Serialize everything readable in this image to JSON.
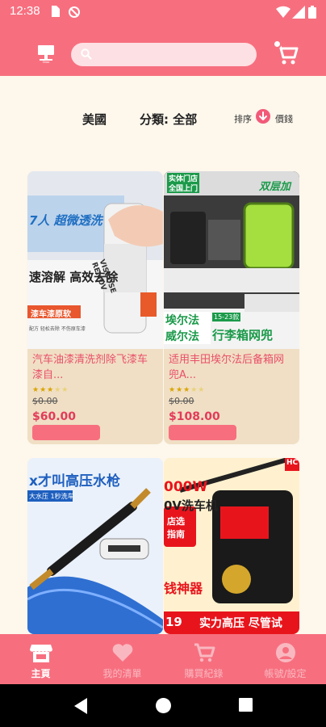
{
  "status_bar": {
    "time": "12:38"
  },
  "header": {
    "logo_icon": "shop-logo-icon",
    "search": {
      "placeholder": "",
      "value": ""
    },
    "cart_icon": "cart-icon"
  },
  "filters": {
    "region": "美國",
    "category": "分類: 全部",
    "sort_label": "排序",
    "sort_value": "價錢"
  },
  "products": [
    {
      "name": "汽车油漆清洗剂除飞漆车漆自...",
      "stars": 3,
      "old_price": "$0.00",
      "price": "$60.00"
    },
    {
      "name": "适用丰田埃尔法后备箱网兜A...",
      "stars": 3,
      "old_price": "$0.00",
      "price": "$108.00"
    },
    {
      "name": "",
      "stars": 0,
      "old_price": "",
      "price": ""
    },
    {
      "name": "",
      "stars": 0,
      "old_price": "",
      "price": ""
    }
  ],
  "image_texts": {
    "p1_banner": "7人 超微透洗",
    "p1_line1": "速溶解 高效去除",
    "p1_tag": "漆车漆原软",
    "p1_small": "配方 轻松去除 不伤原车漆",
    "p1_can": "VISCOSE REMOV",
    "p2_tag1": "实体门店",
    "p2_tag2": "全国上门",
    "p2_top": "双层加",
    "p2_range": "15-23款",
    "p2_brand1": "埃尔法",
    "p2_brand2": "威尔法",
    "p2_bottom": "行李箱网兜",
    "p3_top": "x才叫高压水枪",
    "p3_small": "大水压 1秒洗车",
    "p4_top": "000W",
    "p4_sub": "0V洗车机",
    "p4_side1": "店选",
    "p4_side2": "指南",
    "p4_mid": "钱神器",
    "p4_num": "19",
    "p4_bottom": "实力高压 尽管试",
    "p4_corner": "HC"
  },
  "bottom_nav": [
    {
      "label": "主頁",
      "icon": "store-icon",
      "active": true
    },
    {
      "label": "我的清單",
      "icon": "heart-icon",
      "active": false
    },
    {
      "label": "購買紀錄",
      "icon": "cart-icon",
      "active": false
    },
    {
      "label": "帳號/設定",
      "icon": "account-icon",
      "active": false
    }
  ],
  "colors": {
    "accent": "#f76f7f",
    "background": "#fdf7ec",
    "card": "#f0dfc4",
    "price": "#e33a5a"
  }
}
